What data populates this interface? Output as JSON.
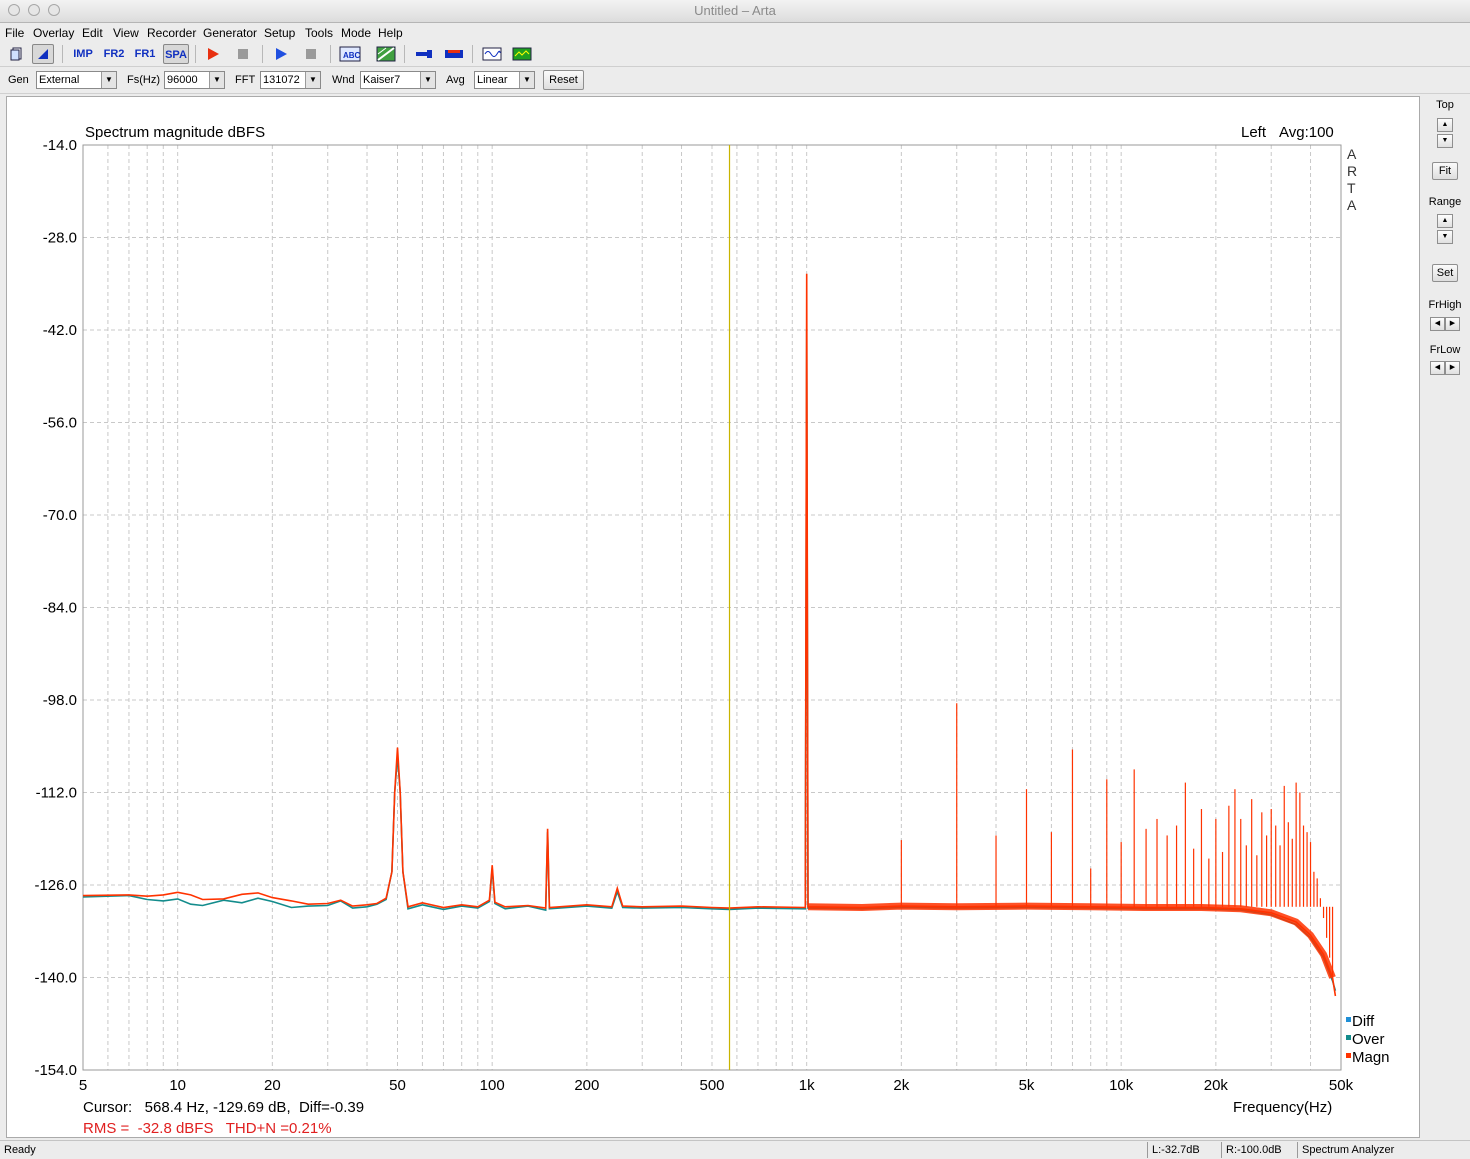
{
  "window": {
    "title": "Untitled – Arta"
  },
  "menu": [
    "File",
    "Overlay",
    "Edit",
    "View",
    "Recorder",
    "Generator",
    "Setup",
    "Tools",
    "Mode",
    "Help"
  ],
  "toolbar": {
    "buttons": [
      {
        "name": "new-document-icon"
      },
      {
        "name": "open-overlay-icon"
      },
      {
        "name": "impulse-mode-button",
        "label": "IMP"
      },
      {
        "name": "fr2-mode-button",
        "label": "FR2"
      },
      {
        "name": "fr1-mode-button",
        "label": "FR1"
      },
      {
        "name": "spa-mode-button",
        "label": "SPA"
      },
      {
        "name": "record-icon"
      },
      {
        "name": "stop-record-icon"
      },
      {
        "name": "play-icon"
      },
      {
        "name": "stop-play-icon"
      },
      {
        "name": "abc-icon"
      },
      {
        "name": "pattern-icon"
      },
      {
        "name": "probe-icon"
      },
      {
        "name": "bars-icon"
      },
      {
        "name": "wave-icon"
      },
      {
        "name": "scope-icon"
      }
    ]
  },
  "params": {
    "gen_label": "Gen",
    "gen_value": "External",
    "fs_label": "Fs(Hz)",
    "fs_value": "96000",
    "fft_label": "FFT",
    "fft_value": "131072",
    "wnd_label": "Wnd",
    "wnd_value": "Kaiser7",
    "avg_label": "Avg",
    "avg_value": "Linear",
    "reset_label": "Reset"
  },
  "side": {
    "top": "Top",
    "fit": "Fit",
    "range": "Range",
    "set": "Set",
    "frhigh": "FrHigh",
    "frlow": "FrLow"
  },
  "plot": {
    "title": "Spectrum magnitude dBFS",
    "channel": "Left",
    "avg": "Avg:100",
    "brand": "A R T A",
    "brand_letters": [
      "A",
      "R",
      "T",
      "A"
    ],
    "xlabel": "Frequency(Hz)",
    "cursor_text": "Cursor:   568.4 Hz, -129.69 dB,  Diff=-0.39",
    "rms_text": "RMS =  -32.8 dBFS   THD+N =0.21%",
    "legend": [
      {
        "label": "Diff",
        "color": "#1f8fd6"
      },
      {
        "label": "Over",
        "color": "#138c8c"
      },
      {
        "label": "Magn",
        "color": "#ff3300"
      }
    ]
  },
  "chart_data": {
    "type": "line",
    "title": "Spectrum magnitude dBFS",
    "xlabel": "Frequency(Hz)",
    "ylabel": "",
    "xscale": "log",
    "xlim": [
      5,
      50000
    ],
    "ylim": [
      -154,
      -14
    ],
    "y_ticks": [
      "-14.0",
      "-28.0",
      "-42.0",
      "-56.0",
      "-70.0",
      "-84.0",
      "-98.0",
      "-112.0",
      "-126.0",
      "-140.0",
      "-154.0"
    ],
    "x_ticks": [
      {
        "f": 5,
        "label": "5"
      },
      {
        "f": 10,
        "label": "10"
      },
      {
        "f": 20,
        "label": "20"
      },
      {
        "f": 50,
        "label": "50"
      },
      {
        "f": 100,
        "label": "100"
      },
      {
        "f": 200,
        "label": "200"
      },
      {
        "f": 500,
        "label": "500"
      },
      {
        "f": 1000,
        "label": "1k"
      },
      {
        "f": 2000,
        "label": "2k"
      },
      {
        "f": 5000,
        "label": "5k"
      },
      {
        "f": 10000,
        "label": "10k"
      },
      {
        "f": 20000,
        "label": "20k"
      },
      {
        "f": 50000,
        "label": "50k"
      }
    ],
    "cursor_freq": 568.4,
    "colors": {
      "magn": "#ff3300",
      "over": "#138c8c",
      "grid": "#c8c8c8",
      "cursor": "#c8b400"
    },
    "series": [
      {
        "name": "Over",
        "points": [
          [
            5,
            -127.8
          ],
          [
            7,
            -127.6
          ],
          [
            8,
            -128.2
          ],
          [
            9,
            -128.4
          ],
          [
            10,
            -128.1
          ],
          [
            11,
            -128.9
          ],
          [
            12,
            -129.1
          ],
          [
            14,
            -128.3
          ],
          [
            16,
            -128.7
          ],
          [
            18,
            -128.0
          ],
          [
            20,
            -128.5
          ],
          [
            23,
            -129.4
          ],
          [
            26,
            -129.2
          ],
          [
            30,
            -129.1
          ],
          [
            33,
            -128.4
          ],
          [
            36,
            -129.5
          ],
          [
            40,
            -129.3
          ],
          [
            43,
            -128.9
          ],
          [
            46,
            -128.2
          ],
          [
            48,
            -124.0
          ],
          [
            49,
            -112
          ],
          [
            50,
            -106.5
          ],
          [
            51,
            -112
          ],
          [
            52,
            -124.0
          ],
          [
            54,
            -129.6
          ],
          [
            60,
            -129.0
          ],
          [
            70,
            -129.7
          ],
          [
            80,
            -129.2
          ],
          [
            90,
            -129.5
          ],
          [
            98,
            -128.5
          ],
          [
            100,
            -123.5
          ],
          [
            102,
            -128.8
          ],
          [
            110,
            -129.6
          ],
          [
            130,
            -129.2
          ],
          [
            148,
            -129.8
          ],
          [
            150,
            -118
          ],
          [
            152,
            -129.6
          ],
          [
            200,
            -129.2
          ],
          [
            240,
            -129.5
          ],
          [
            250,
            -127
          ],
          [
            260,
            -129.4
          ],
          [
            300,
            -129.5
          ],
          [
            400,
            -129.4
          ],
          [
            500,
            -129.6
          ],
          [
            568,
            -129.7
          ],
          [
            700,
            -129.5
          ],
          [
            990,
            -129.6
          ],
          [
            1000,
            -42
          ],
          [
            1010,
            -129.5
          ],
          [
            1500,
            -129.6
          ],
          [
            2000,
            -129.4
          ],
          [
            3000,
            -129.5
          ],
          [
            5000,
            -129.4
          ],
          [
            8000,
            -129.5
          ],
          [
            12000,
            -129.6
          ],
          [
            18000,
            -129.6
          ],
          [
            24000,
            -129.8
          ],
          [
            30000,
            -130.5
          ],
          [
            36000,
            -132
          ],
          [
            40000,
            -134
          ],
          [
            44000,
            -137
          ],
          [
            47000,
            -140.5
          ],
          [
            48000,
            -142
          ]
        ]
      },
      {
        "name": "Magn",
        "points": [
          [
            5,
            -127.6
          ],
          [
            7,
            -127.5
          ],
          [
            8,
            -127.7
          ],
          [
            9,
            -127.5
          ],
          [
            10,
            -127.1
          ],
          [
            11,
            -127.5
          ],
          [
            12,
            -128.2
          ],
          [
            14,
            -128.1
          ],
          [
            16,
            -127.4
          ],
          [
            18,
            -127.2
          ],
          [
            20,
            -127.9
          ],
          [
            23,
            -128.4
          ],
          [
            26,
            -128.9
          ],
          [
            30,
            -128.8
          ],
          [
            33,
            -128.3
          ],
          [
            36,
            -129.2
          ],
          [
            40,
            -129.0
          ],
          [
            43,
            -128.8
          ],
          [
            46,
            -128.0
          ],
          [
            48,
            -124.0
          ],
          [
            49,
            -112
          ],
          [
            50,
            -105.2
          ],
          [
            51,
            -112
          ],
          [
            52,
            -124.0
          ],
          [
            54,
            -129.3
          ],
          [
            60,
            -128.7
          ],
          [
            70,
            -129.4
          ],
          [
            80,
            -129.0
          ],
          [
            90,
            -129.3
          ],
          [
            98,
            -128.3
          ],
          [
            100,
            -123.0
          ],
          [
            102,
            -128.6
          ],
          [
            110,
            -129.3
          ],
          [
            130,
            -129.1
          ],
          [
            148,
            -129.5
          ],
          [
            150,
            -117.5
          ],
          [
            152,
            -129.4
          ],
          [
            200,
            -129.0
          ],
          [
            240,
            -129.3
          ],
          [
            250,
            -126.5
          ],
          [
            260,
            -129.2
          ],
          [
            300,
            -129.3
          ],
          [
            400,
            -129.2
          ],
          [
            500,
            -129.4
          ],
          [
            568,
            -129.5
          ],
          [
            700,
            -129.3
          ],
          [
            990,
            -129.4
          ],
          [
            1000,
            -33.5
          ],
          [
            1010,
            -129.3
          ],
          [
            1500,
            -129.4
          ],
          [
            2000,
            -129.2
          ],
          [
            3000,
            -129.3
          ],
          [
            5000,
            -129.2
          ],
          [
            8000,
            -129.3
          ],
          [
            12000,
            -129.4
          ],
          [
            18000,
            -129.4
          ],
          [
            24000,
            -129.6
          ],
          [
            30000,
            -130.2
          ],
          [
            36000,
            -131.6
          ],
          [
            40000,
            -133.6
          ],
          [
            44000,
            -136.5
          ],
          [
            47000,
            -140
          ],
          [
            48000,
            -142.8
          ]
        ]
      }
    ],
    "harmonics": [
      {
        "f": 2000,
        "db": -119.2
      },
      {
        "f": 3000,
        "db": -98.5
      },
      {
        "f": 4000,
        "db": -118.5
      },
      {
        "f": 5000,
        "db": -111.5
      },
      {
        "f": 6000,
        "db": -118.0
      },
      {
        "f": 7000,
        "db": -105.5
      },
      {
        "f": 8000,
        "db": -123.5
      },
      {
        "f": 9000,
        "db": -110.0
      },
      {
        "f": 10000,
        "db": -119.5
      },
      {
        "f": 11000,
        "db": -108.5
      },
      {
        "f": 12000,
        "db": -117.5
      },
      {
        "f": 13000,
        "db": -116.0
      },
      {
        "f": 14000,
        "db": -118.5
      },
      {
        "f": 15000,
        "db": -117.0
      },
      {
        "f": 16000,
        "db": -110.5
      },
      {
        "f": 17000,
        "db": -120.5
      },
      {
        "f": 18000,
        "db": -114.5
      },
      {
        "f": 19000,
        "db": -122.0
      },
      {
        "f": 20000,
        "db": -116.0
      },
      {
        "f": 21000,
        "db": -121.0
      },
      {
        "f": 22000,
        "db": -114.0
      },
      {
        "f": 23000,
        "db": -111.5
      },
      {
        "f": 24000,
        "db": -116.0
      },
      {
        "f": 25000,
        "db": -120.0
      },
      {
        "f": 26000,
        "db": -113.0
      },
      {
        "f": 27000,
        "db": -121.5
      },
      {
        "f": 28000,
        "db": -115.0
      },
      {
        "f": 29000,
        "db": -118.5
      },
      {
        "f": 30000,
        "db": -114.5
      },
      {
        "f": 31000,
        "db": -117.0
      },
      {
        "f": 32000,
        "db": -120.0
      },
      {
        "f": 33000,
        "db": -111.0
      },
      {
        "f": 34000,
        "db": -116.5
      },
      {
        "f": 35000,
        "db": -119.0
      },
      {
        "f": 36000,
        "db": -110.5
      },
      {
        "f": 37000,
        "db": -112.0
      },
      {
        "f": 38000,
        "db": -117.0
      },
      {
        "f": 39000,
        "db": -118.0
      },
      {
        "f": 40000,
        "db": -119.5
      },
      {
        "f": 41000,
        "db": -124.0
      },
      {
        "f": 42000,
        "db": -125.0
      },
      {
        "f": 43000,
        "db": -128.0
      },
      {
        "f": 44000,
        "db": -131.0
      },
      {
        "f": 45000,
        "db": -134.0
      },
      {
        "f": 46000,
        "db": -137.0
      },
      {
        "f": 47000,
        "db": -140.5
      }
    ]
  },
  "status": {
    "ready": "Ready",
    "left_level": "L:-32.7dB",
    "right_level": "R:-100.0dB",
    "mode": "Spectrum Analyzer"
  }
}
